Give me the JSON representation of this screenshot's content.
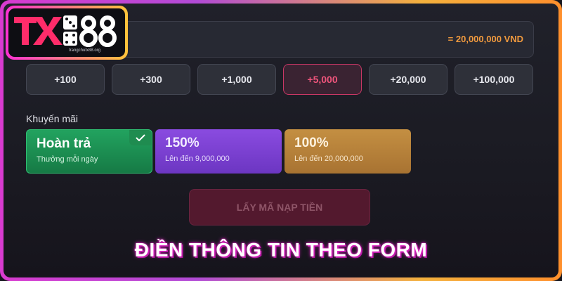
{
  "amount": {
    "converted": "= 20,000,000 VND"
  },
  "chips": [
    {
      "label": "+100",
      "active": false
    },
    {
      "label": "+300",
      "active": false
    },
    {
      "label": "+1,000",
      "active": false
    },
    {
      "label": "+5,000",
      "active": true
    },
    {
      "label": "+20,000",
      "active": false
    },
    {
      "label": "+100,000",
      "active": false
    }
  ],
  "promotions": {
    "title": "Khuyến mãi",
    "items": [
      {
        "name": "Hoàn trả",
        "sub": "Thưởng mỗi ngày",
        "selected": true
      },
      {
        "name": "150%",
        "sub": "Lên đến 9,000,000",
        "selected": false
      },
      {
        "name": "100%",
        "sub": "Lên đến 20,000,000",
        "selected": false
      }
    ]
  },
  "submit_label": "LẤY MÃ NẠP TIỀN",
  "caption": "ĐIỀN THÔNG TIN THEO FORM",
  "logo": {
    "brand": "TX88",
    "site": "trangchutx88.org"
  },
  "colors": {
    "accent_pink": "#f0557c",
    "amount_orange": "#f19a3e",
    "promo_green": "#22a35f",
    "promo_purple": "#8a4be0",
    "promo_gold": "#c48f42"
  },
  "icons": {
    "check": "check-icon",
    "dice": "dice-icon"
  }
}
